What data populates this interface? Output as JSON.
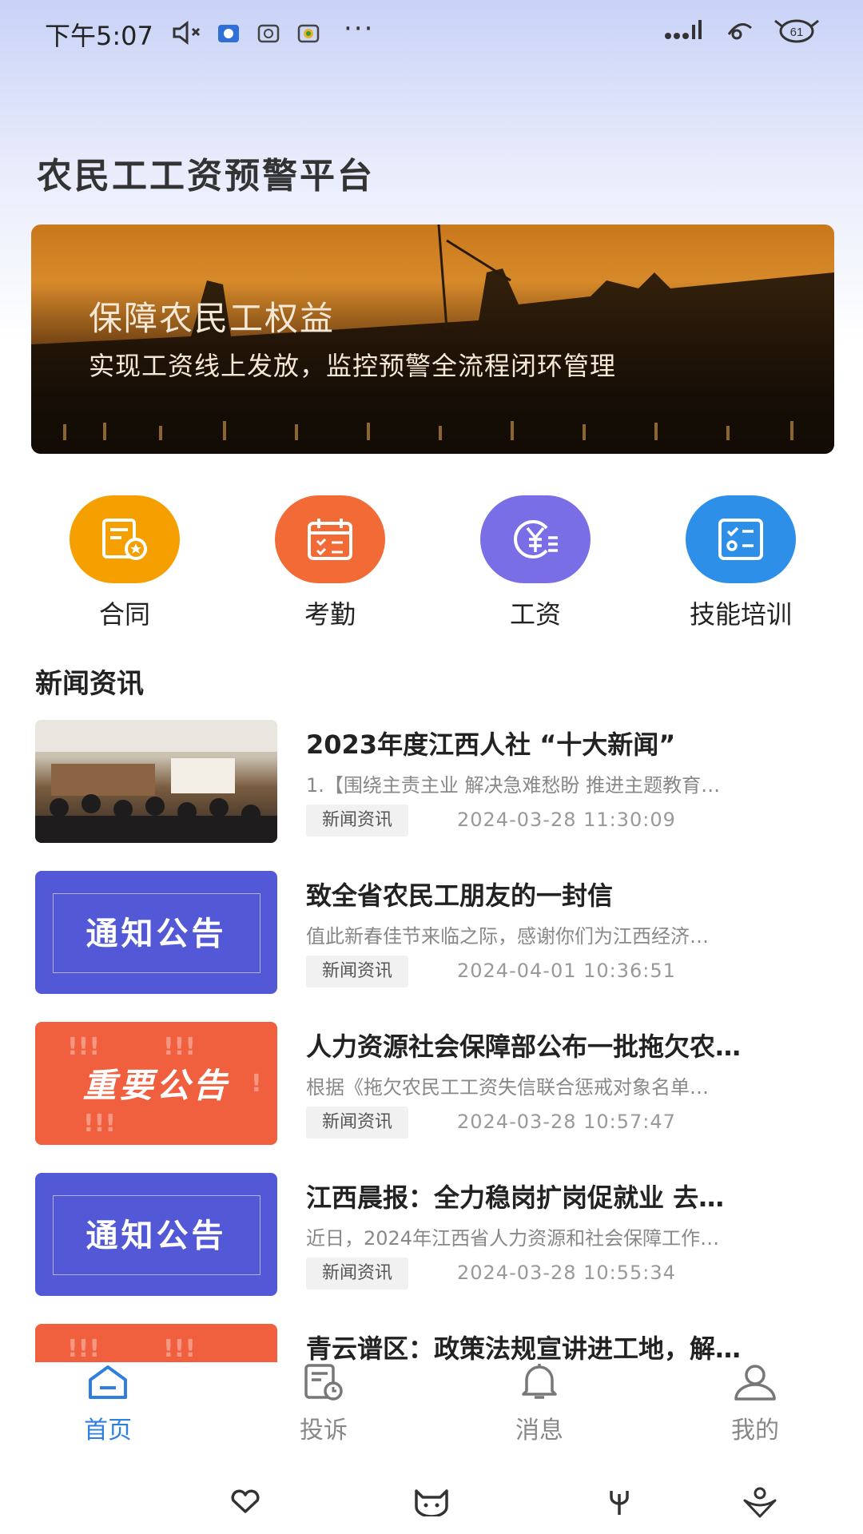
{
  "status_bar": {
    "time": "下午5:07",
    "more": "···",
    "battery": "61"
  },
  "app_title": "农民工工资预警平台",
  "banner": {
    "headline": "保障农民工权益",
    "subline": "实现工资线上发放，监控预警全流程闭环管理"
  },
  "quick_actions": [
    {
      "label": "合同",
      "color": "#f5a000",
      "icon": "contract-icon"
    },
    {
      "label": "考勤",
      "color": "#f26a35",
      "icon": "calendar-icon"
    },
    {
      "label": "工资",
      "color": "#7a6ee6",
      "icon": "yuan-icon"
    },
    {
      "label": "技能培训",
      "color": "#2e8fe8",
      "icon": "checklist-icon"
    }
  ],
  "news_section_title": "新闻资讯",
  "news": [
    {
      "title": "2023年度江西人社 “十大新闻”",
      "summary": "1.【围绕主责主业 解决急难愁盼 推进主题教育…",
      "tag": "新闻资讯",
      "date": "2024-03-28 11:30:09",
      "thumb": "meeting-photo"
    },
    {
      "title": "致全省农民工朋友的一封信",
      "summary": "值此新春佳节来临之际，感谢你们为江西经济…",
      "tag": "新闻资讯",
      "date": "2024-04-01 10:36:51",
      "thumb": "notice",
      "thumb_text": "通知公告"
    },
    {
      "title": "人力资源社会保障部公布一批拖欠农…",
      "summary": "根据《拖欠农民工工资失信联合惩戒对象名单…",
      "tag": "新闻资讯",
      "date": "2024-03-28 10:57:47",
      "thumb": "important",
      "thumb_text": "重要公告"
    },
    {
      "title": "江西晨报：全力稳岗扩岗促就业 去…",
      "summary": "近日，2024年江西省人力资源和社会保障工作…",
      "tag": "新闻资讯",
      "date": "2024-03-28 10:55:34",
      "thumb": "notice",
      "thumb_text": "通知公告"
    },
    {
      "title": "青云谱区：政策法规宣讲进工地，解…",
      "thumb": "important"
    }
  ],
  "bottom_nav": [
    {
      "label": "首页",
      "icon": "home-icon",
      "active": true
    },
    {
      "label": "投诉",
      "icon": "complaint-icon",
      "active": false
    },
    {
      "label": "消息",
      "icon": "bell-icon",
      "active": false
    },
    {
      "label": "我的",
      "icon": "user-icon",
      "active": false
    }
  ],
  "colors": {
    "accent": "#2f7fe0",
    "notice_blue": "#5359d6",
    "notice_red": "#f0603f"
  }
}
